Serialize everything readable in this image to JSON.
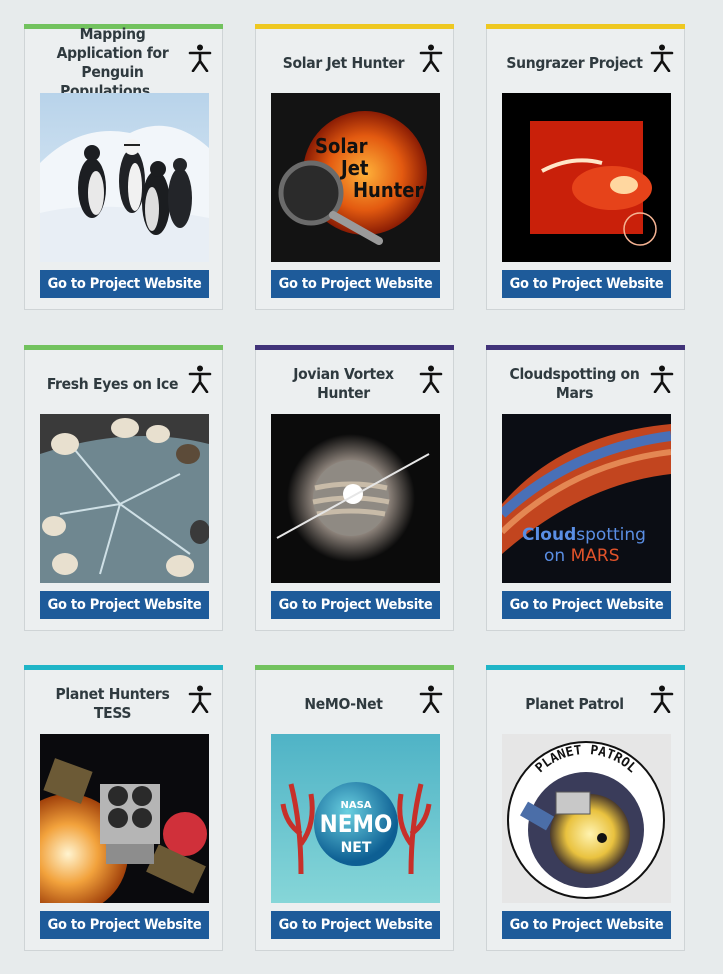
{
  "cards": [
    {
      "title": "Mapping Application for Penguin Populations...",
      "button": "Go to Project Website",
      "accent": "#72c25e",
      "image_alt": "penguins on ice"
    },
    {
      "title": "Solar Jet Hunter",
      "button": "Go to Project Website",
      "accent": "#eec821",
      "image_alt": "sun with magnifying glass",
      "image_text": [
        "Solar",
        "Jet",
        "Hunter"
      ]
    },
    {
      "title": "Sungrazer Project",
      "button": "Go to Project Website",
      "accent": "#eec821",
      "image_alt": "comet near sun"
    },
    {
      "title": "Fresh Eyes on Ice",
      "button": "Go to Project Website",
      "accent": "#72c25e",
      "image_alt": "boots around cracked ice"
    },
    {
      "title": "Jovian Vortex Hunter",
      "button": "Go to Project Website",
      "accent": "#413379",
      "image_alt": "jupiter with spacecraft"
    },
    {
      "title": "Cloudspotting on Mars",
      "button": "Go to Project Website",
      "accent": "#413379",
      "image_alt": "mars horizon",
      "image_text": [
        "Cloud",
        "spotting",
        "on ",
        "MARS"
      ]
    },
    {
      "title": "Planet Hunters TESS",
      "button": "Go to Project Website",
      "accent": "#1fb5c7",
      "image_alt": "TESS satellite"
    },
    {
      "title": "NeMO-Net",
      "button": "Go to Project Website",
      "accent": "#72c25e",
      "image_alt": "NeMO-Net logo",
      "image_text": [
        "NASA",
        "NEMO",
        "NET"
      ]
    },
    {
      "title": "Planet Patrol",
      "button": "Go to Project Website",
      "accent": "#1fb5c7",
      "image_alt": "Planet Patrol logo",
      "image_text": [
        "PLANET PATROL"
      ]
    }
  ],
  "icons": {
    "accessibility": "accessibility-person-icon"
  }
}
